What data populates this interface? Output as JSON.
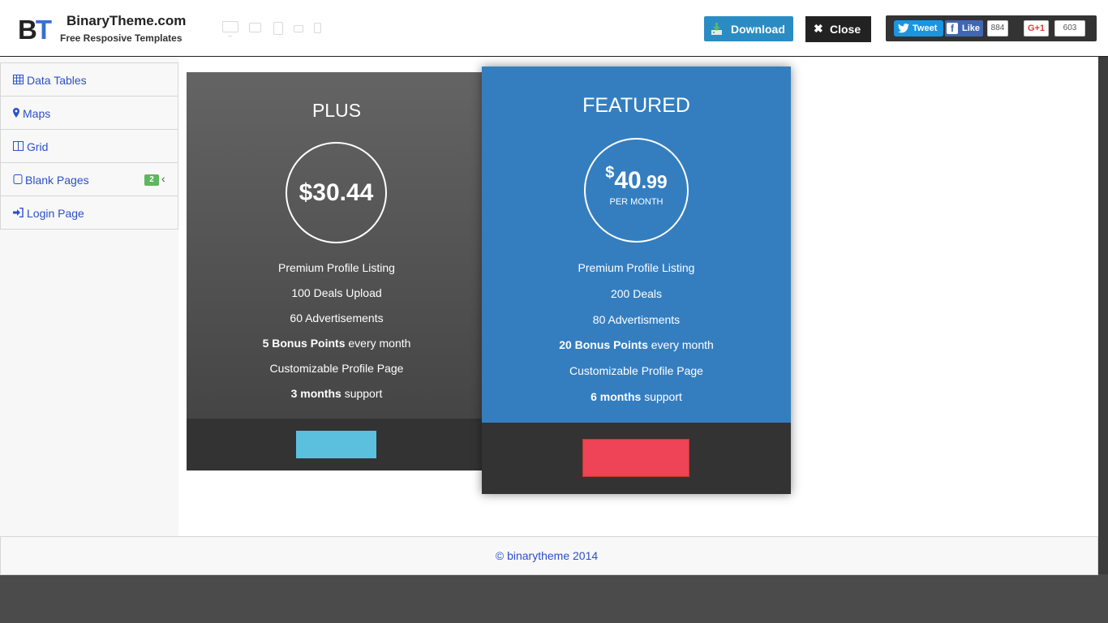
{
  "header": {
    "logo_mark_b": "B",
    "logo_mark_t": "T",
    "logo_title": "BinaryTheme.com",
    "logo_subtitle": "Free Resposive Templates",
    "download_label": "Download",
    "close_label": "Close",
    "tweet_label": "Tweet",
    "like_label": "Like",
    "like_count": "884",
    "gplus_label": "G+1",
    "gplus_count": "603",
    "colors": {
      "download": "#2b8cc4",
      "close": "#222222",
      "tweet": "#1b95e0",
      "facebook": "#4267b2"
    }
  },
  "sidebar": {
    "items": [
      {
        "label": "Data Tables",
        "icon": "table-icon"
      },
      {
        "label": "Maps",
        "icon": "map-marker-icon"
      },
      {
        "label": "Grid",
        "icon": "columns-icon"
      },
      {
        "label": "Blank Pages",
        "icon": "square-icon",
        "badge": "2",
        "chevron": "‹"
      },
      {
        "label": "Login Page",
        "icon": "sign-in-icon"
      }
    ]
  },
  "pricing": {
    "plus": {
      "title": "PLUS",
      "price": "$30.44",
      "features": [
        {
          "text": "Premium Profile Listing"
        },
        {
          "text": "100 Deals Upload"
        },
        {
          "text": "60 Advertisements"
        },
        {
          "bold": "5 Bonus Points",
          "text": " every month"
        },
        {
          "text": "Customizable Profile Page"
        },
        {
          "bold": "3 months",
          "text": " support"
        }
      ],
      "button_color": "#5bc0de"
    },
    "featured": {
      "title": "FEATURED",
      "currency": "$",
      "price_whole": "40",
      "price_decimal": ".99",
      "period": "PER MONTH",
      "features": [
        {
          "text": "Premium Profile Listing"
        },
        {
          "text": "200 Deals"
        },
        {
          "text": "80 Advertisments"
        },
        {
          "bold": "20 Bonus Points",
          "text": " every month"
        },
        {
          "text": "Customizable Profile Page"
        },
        {
          "bold": "6 months",
          "text": " support"
        }
      ],
      "button_color": "#ef4357",
      "card_color": "#347ec0"
    }
  },
  "footer": {
    "text": "© binarytheme  2014"
  }
}
